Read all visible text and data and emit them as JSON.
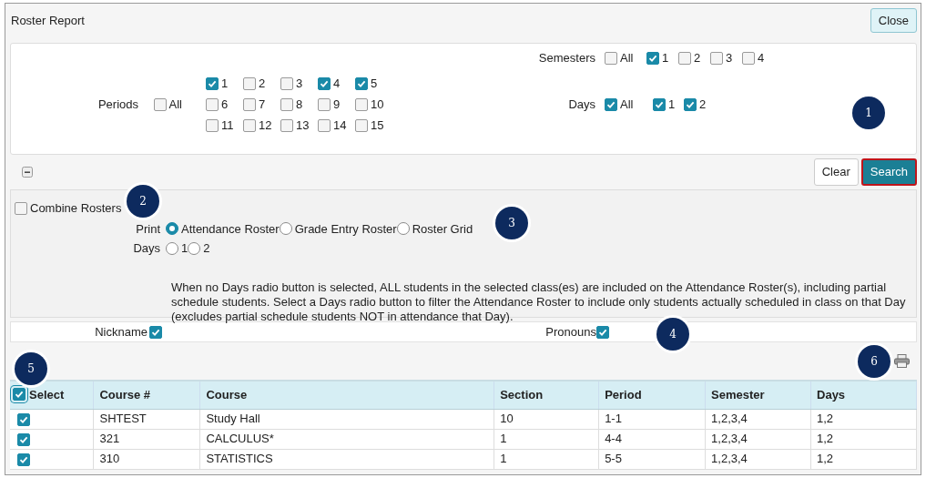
{
  "window": {
    "title": "Roster Report",
    "close_button": "Close"
  },
  "semesters": {
    "label": "Semesters",
    "options": [
      {
        "label": "All",
        "checked": false
      },
      {
        "label": "1",
        "checked": true
      },
      {
        "label": "2",
        "checked": false
      },
      {
        "label": "3",
        "checked": false
      },
      {
        "label": "4",
        "checked": false
      }
    ]
  },
  "periods": {
    "label": "Periods",
    "all": {
      "label": "All",
      "checked": false
    },
    "options": [
      {
        "label": "1",
        "checked": true
      },
      {
        "label": "2",
        "checked": false
      },
      {
        "label": "3",
        "checked": false
      },
      {
        "label": "4",
        "checked": true
      },
      {
        "label": "5",
        "checked": true
      },
      {
        "label": "6",
        "checked": false
      },
      {
        "label": "7",
        "checked": false
      },
      {
        "label": "8",
        "checked": false
      },
      {
        "label": "9",
        "checked": false
      },
      {
        "label": "10",
        "checked": false
      },
      {
        "label": "11",
        "checked": false
      },
      {
        "label": "12",
        "checked": false
      },
      {
        "label": "13",
        "checked": false
      },
      {
        "label": "14",
        "checked": false
      },
      {
        "label": "15",
        "checked": false
      }
    ]
  },
  "days_filter": {
    "label": "Days",
    "options": [
      {
        "label": "All",
        "checked": true
      },
      {
        "label": "1",
        "checked": true
      },
      {
        "label": "2",
        "checked": true
      }
    ]
  },
  "clear_button": "Clear",
  "search_button": "Search",
  "combine_rosters": {
    "label": "Combine Rosters",
    "checked": false
  },
  "print": {
    "label": "Print",
    "options": [
      {
        "label": "Attendance Roster",
        "selected": true
      },
      {
        "label": "Grade Entry Roster",
        "selected": false
      },
      {
        "label": "Roster Grid",
        "selected": false
      }
    ]
  },
  "days_radio": {
    "label": "Days",
    "options": [
      {
        "label": "1",
        "selected": false
      },
      {
        "label": "2",
        "selected": false
      }
    ]
  },
  "note": "When no Days radio button is selected, ALL students in the selected class(es) are included on the Attendance Roster(s), including partial schedule students. Select a Days radio button to filter the Attendance Roster to include only students actually scheduled in class on that Day (excludes partial schedule students NOT in attendance that Day).",
  "nickname": {
    "label": "Nickname",
    "checked": true
  },
  "pronouns": {
    "label": "Pronouns",
    "checked": true
  },
  "table": {
    "select_all": {
      "label": "Select",
      "checked": true
    },
    "columns": [
      "Course #",
      "Course",
      "Section",
      "Period",
      "Semester",
      "Days"
    ],
    "rows": [
      {
        "checked": true,
        "cells": [
          "SHTEST",
          "Study Hall",
          "10",
          "1-1",
          "1,2,3,4",
          "1,2"
        ]
      },
      {
        "checked": true,
        "cells": [
          "321",
          "CALCULUS*",
          "1",
          "4-4",
          "1,2,3,4",
          "1,2"
        ]
      },
      {
        "checked": true,
        "cells": [
          "310",
          "STATISTICS",
          "1",
          "5-5",
          "1,2,3,4",
          "1,2"
        ]
      }
    ]
  },
  "callouts": [
    "1",
    "2",
    "3",
    "4",
    "5",
    "6"
  ]
}
